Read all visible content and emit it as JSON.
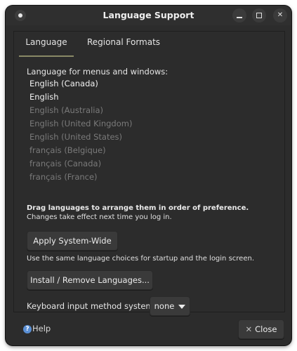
{
  "window": {
    "title": "Language Support"
  },
  "tabs": [
    {
      "label": "Language"
    },
    {
      "label": "Regional Formats"
    }
  ],
  "language": {
    "section_label": "Language for menus and windows:",
    "items": [
      {
        "label": "English (Canada)",
        "state": "active"
      },
      {
        "label": "English",
        "state": "active"
      },
      {
        "label": "English (Australia)",
        "state": "inactive"
      },
      {
        "label": "English (United Kingdom)",
        "state": "inactive"
      },
      {
        "label": "English (United States)",
        "state": "inactive"
      },
      {
        "label": "français (Belgique)",
        "state": "inactive"
      },
      {
        "label": "français (Canada)",
        "state": "inactive"
      },
      {
        "label": "français (France)",
        "state": "inactive"
      }
    ],
    "drag_hint": "Drag languages to arrange them in order of preference.",
    "effect_hint": "Changes take effect next time you log in.",
    "apply_button": "Apply System-Wide",
    "startup_hint": "Use the same language choices for startup and the login screen.",
    "install_button": "Install / Remove Languages...",
    "keyboard_label": "Keyboard input method system:",
    "keyboard_value": "none"
  },
  "footer": {
    "help_label": "Help",
    "help_icon": "?",
    "close_label": "Close",
    "close_icon": "✕"
  },
  "icons": {
    "window_menu": "menu-dot-icon",
    "minimize": "minimize-icon",
    "maximize": "maximize-icon",
    "close": "close-icon"
  },
  "colors": {
    "window_bg": "#2c2c2c",
    "active_tab_underline": "#8a8a66",
    "inactive_text": "#7a7a7a",
    "help_icon": "#5a8fd4"
  }
}
